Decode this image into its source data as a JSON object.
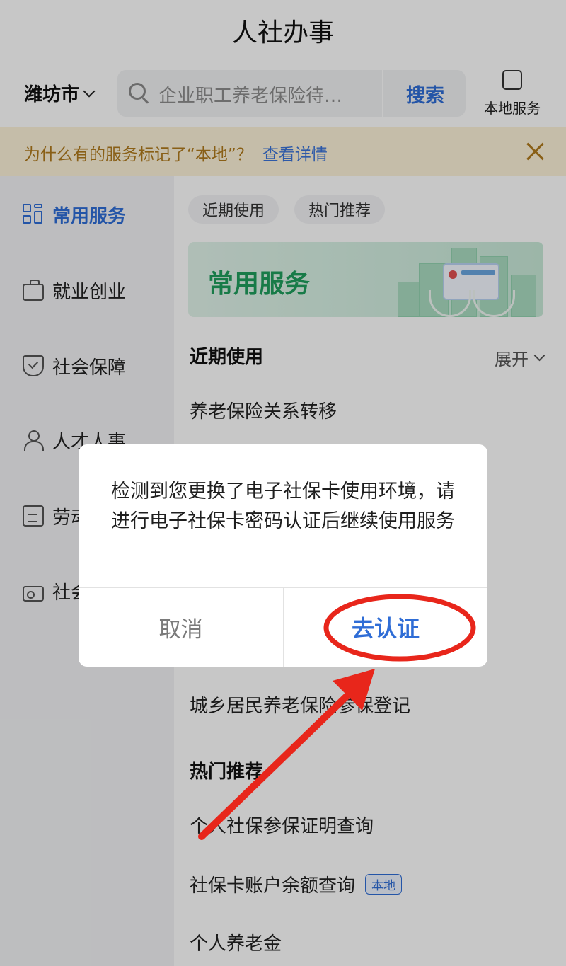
{
  "header": {
    "title": "人社办事"
  },
  "topbar": {
    "city": "潍坊市",
    "search_placeholder": "企业职工养老保险待…",
    "search_button": "搜索",
    "local_service_label": "本地服务"
  },
  "notice": {
    "text": "为什么有的服务标记了“本地”？",
    "link": "查看详情"
  },
  "sidebar": {
    "items": [
      {
        "label": "常用服务",
        "icon": "grid-icon",
        "active": true
      },
      {
        "label": "就业创业",
        "icon": "briefcase-icon",
        "active": false
      },
      {
        "label": "社会保障",
        "icon": "shield-icon",
        "active": false
      },
      {
        "label": "人才人事",
        "icon": "user-icon",
        "active": false
      },
      {
        "label": "劳动",
        "icon": "document-icon",
        "active": false
      },
      {
        "label": "社会",
        "icon": "id-card-icon",
        "active": false
      }
    ]
  },
  "main": {
    "tabs": [
      "近期使用",
      "热门推荐"
    ],
    "banner_title": "常用服务",
    "recent": {
      "title": "近期使用",
      "expand": "展开",
      "items": [
        "养老保险关系转移",
        "城乡居民养老保险参保登记"
      ]
    },
    "hot": {
      "title": "热门推荐",
      "items": [
        {
          "label": "个人社保参保证明查询",
          "tag": ""
        },
        {
          "label": "社保卡账户余额查询",
          "tag": "本地"
        },
        {
          "label": "个人养老金",
          "tag": ""
        }
      ]
    }
  },
  "dialog": {
    "message": "检测到您更换了电子社保卡使用环境，请进行电子社保卡密码认证后继续使用服务",
    "cancel": "取消",
    "confirm": "去认证"
  },
  "colors": {
    "accent": "#2f6dd6",
    "annotation": "#e8261b",
    "notice_bg": "#fdf3d9",
    "banner_green": "#1f9e5d"
  }
}
